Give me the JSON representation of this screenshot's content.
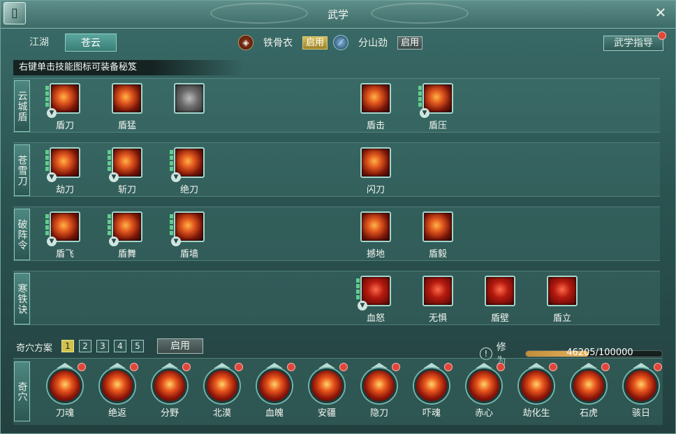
{
  "window": {
    "title": "武学"
  },
  "tabs": [
    {
      "label": "江湖",
      "active": false
    },
    {
      "label": "苍云",
      "active": true
    }
  ],
  "stances": [
    {
      "name": "铁骨衣",
      "button": "启用",
      "icon": "shield-icon"
    },
    {
      "name": "分山劲",
      "button": "启用",
      "icon": "blade-icon"
    }
  ],
  "guide_button": "武学指导",
  "hint": "右键单击技能图标可装备秘笈",
  "rows": [
    {
      "label": "云城盾",
      "skills": [
        {
          "name": "盾刀",
          "slot": 0,
          "secret": true
        },
        {
          "name": "盾猛",
          "slot": 1,
          "secret": false
        },
        {
          "name": "",
          "slot": 2,
          "secret": false,
          "locked": true
        },
        {
          "name": "盾击",
          "slot": 5,
          "secret": false
        },
        {
          "name": "盾压",
          "slot": 6,
          "secret": true
        }
      ]
    },
    {
      "label": "苍雪刀",
      "skills": [
        {
          "name": "劫刀",
          "slot": 0,
          "secret": true
        },
        {
          "name": "斩刀",
          "slot": 1,
          "secret": true
        },
        {
          "name": "绝刀",
          "slot": 2,
          "secret": true
        },
        {
          "name": "闪刀",
          "slot": 5,
          "secret": false
        }
      ]
    },
    {
      "label": "破阵令",
      "skills": [
        {
          "name": "盾飞",
          "slot": 0,
          "secret": true
        },
        {
          "name": "盾舞",
          "slot": 1,
          "secret": true
        },
        {
          "name": "盾墙",
          "slot": 2,
          "secret": true
        },
        {
          "name": "撼地",
          "slot": 5,
          "secret": false
        },
        {
          "name": "盾毅",
          "slot": 6,
          "secret": false
        }
      ]
    },
    {
      "label": "寒铁诀",
      "skills": [
        {
          "name": "血怒",
          "slot": 5,
          "secret": true
        },
        {
          "name": "无惧",
          "slot": 6,
          "secret": false
        },
        {
          "name": "盾壁",
          "slot": 7,
          "secret": false
        },
        {
          "name": "盾立",
          "slot": 8,
          "secret": false
        }
      ]
    }
  ],
  "scheme": {
    "label": "奇穴方案",
    "numbers": [
      "1",
      "2",
      "3",
      "4",
      "5"
    ],
    "active": 0,
    "enable_button": "启用"
  },
  "xiuwei": {
    "label": "修为",
    "value_text": "46205/100000",
    "fraction": 0.462
  },
  "qixue": {
    "label": "奇穴",
    "items": [
      "刀魂",
      "绝返",
      "分野",
      "北漠",
      "血魄",
      "安疆",
      "隐刀",
      "吓魂",
      "赤心",
      "劫化生",
      "石虎",
      "骇日"
    ]
  },
  "colors": {
    "accent": "#cfc24f",
    "frame": "#3b6d6a",
    "alert_dot": "#e0463b",
    "progress": "#e7b45c"
  }
}
